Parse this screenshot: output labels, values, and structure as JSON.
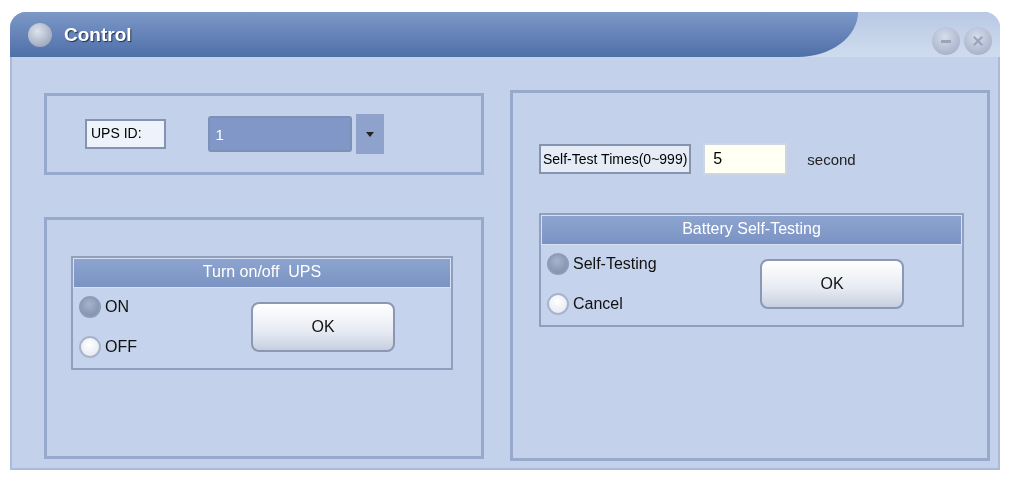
{
  "window": {
    "title": "Control"
  },
  "ups_id": {
    "label": "UPS ID:",
    "value": "1"
  },
  "power_group": {
    "title": "Turn on/off  UPS",
    "button": "OK",
    "options": [
      {
        "label": "ON",
        "selected": true
      },
      {
        "label": "OFF",
        "selected": false
      }
    ]
  },
  "self_test": {
    "label": "Self-Test Times(0~999)",
    "value": "5",
    "unit": "second"
  },
  "battery_group": {
    "title": "Battery Self-Testing",
    "button": "OK",
    "options": [
      {
        "label": "Self-Testing",
        "selected": true
      },
      {
        "label": "Cancel",
        "selected": false
      }
    ]
  }
}
